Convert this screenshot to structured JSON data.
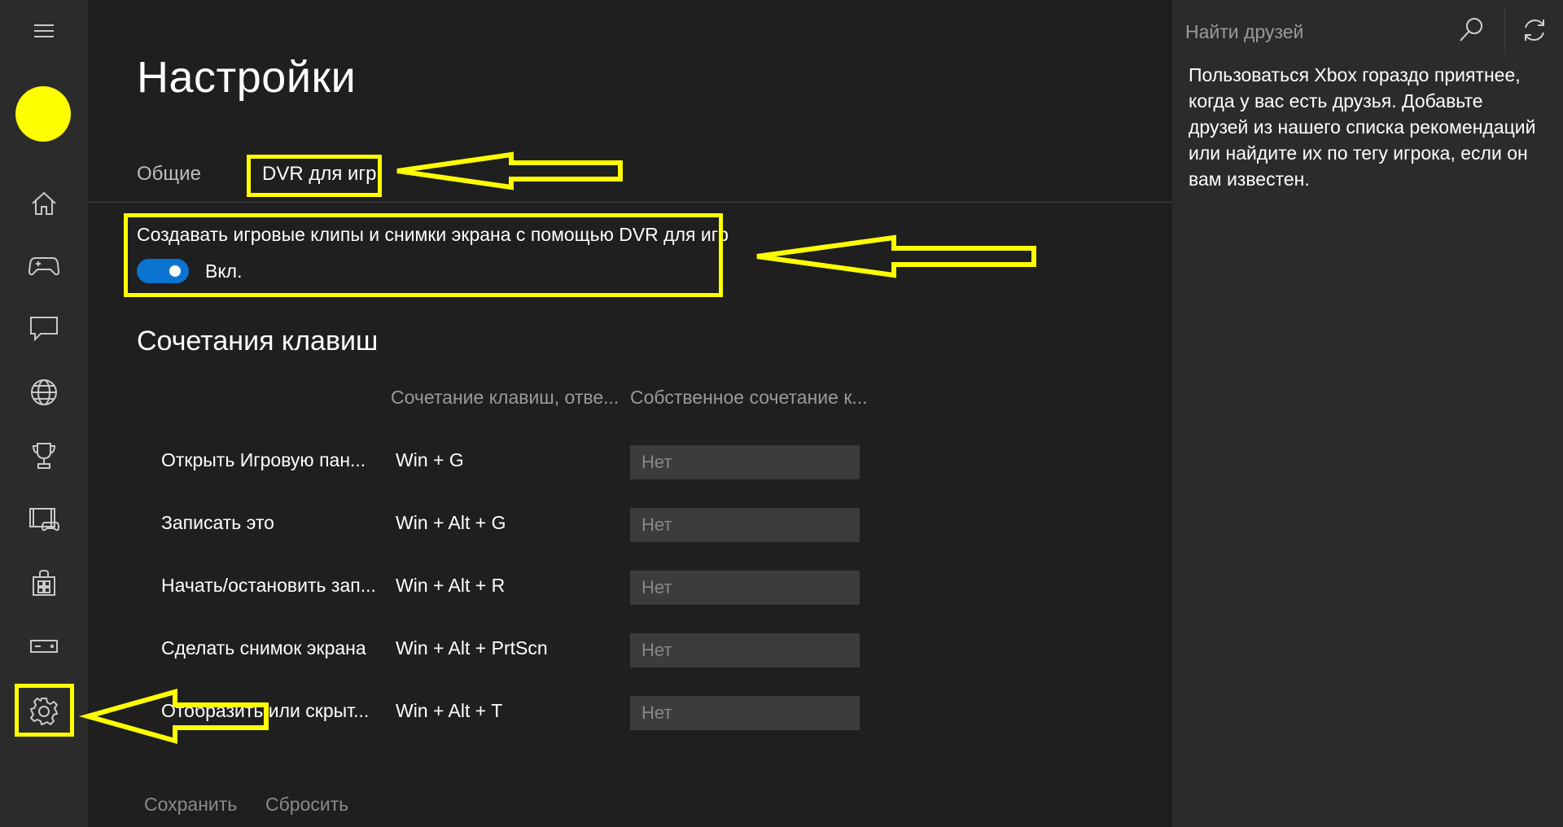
{
  "page": {
    "title": "Настройки",
    "tabs": [
      {
        "label": "Общие",
        "active": false
      },
      {
        "label": "DVR для игр",
        "active": true
      }
    ]
  },
  "nav": {
    "items": [
      {
        "icon": "hamburger-menu-icon"
      },
      {
        "icon": "avatar"
      },
      {
        "icon": "home-icon"
      },
      {
        "icon": "gamepad-icon"
      },
      {
        "icon": "messages-icon"
      },
      {
        "icon": "globe-icon"
      },
      {
        "icon": "trophy-icon"
      },
      {
        "icon": "game-dvr-icon"
      },
      {
        "icon": "store-icon"
      },
      {
        "icon": "connect-icon"
      },
      {
        "icon": "settings-gear-icon"
      }
    ],
    "avatar_color": "#ffff00"
  },
  "dvr": {
    "setting_label": "Создавать игровые клипы и снимки экрана с помощью DVR для игр",
    "toggle_on": true,
    "toggle_text": "Вкл."
  },
  "shortcuts": {
    "section_title": "Сочетания клавиш",
    "col_default": "Сочетание клавиш, отве...",
    "col_custom": "Собственное сочетание к...",
    "rows": [
      {
        "label": "Открыть Игровую пан...",
        "combo": "Win + G",
        "custom_placeholder": "Нет"
      },
      {
        "label": "Записать это",
        "combo": "Win + Alt + G",
        "custom_placeholder": "Нет"
      },
      {
        "label": "Начать/остановить зап...",
        "combo": "Win + Alt + R",
        "custom_placeholder": "Нет"
      },
      {
        "label": "Сделать снимок экрана",
        "combo": "Win + Alt + PrtScn",
        "custom_placeholder": "Нет"
      },
      {
        "label": "Отобразить или скрыт...",
        "combo": "Win + Alt + T",
        "custom_placeholder": "Нет"
      }
    ]
  },
  "footer": {
    "save_label": "Сохранить",
    "reset_label": "Сбросить"
  },
  "friends": {
    "search_placeholder": "Найти друзей",
    "message": "Пользоваться Xbox гораздо приятнее, когда у вас есть друзья. Добавьте друзей из нашего списка рекомендаций или найдите их по тегу игрока, если он вам известен."
  },
  "colors": {
    "accent": "#0a74d0",
    "annotation": "#ffff00",
    "background": "#1f1f1f",
    "rail": "#2b2b2b"
  }
}
